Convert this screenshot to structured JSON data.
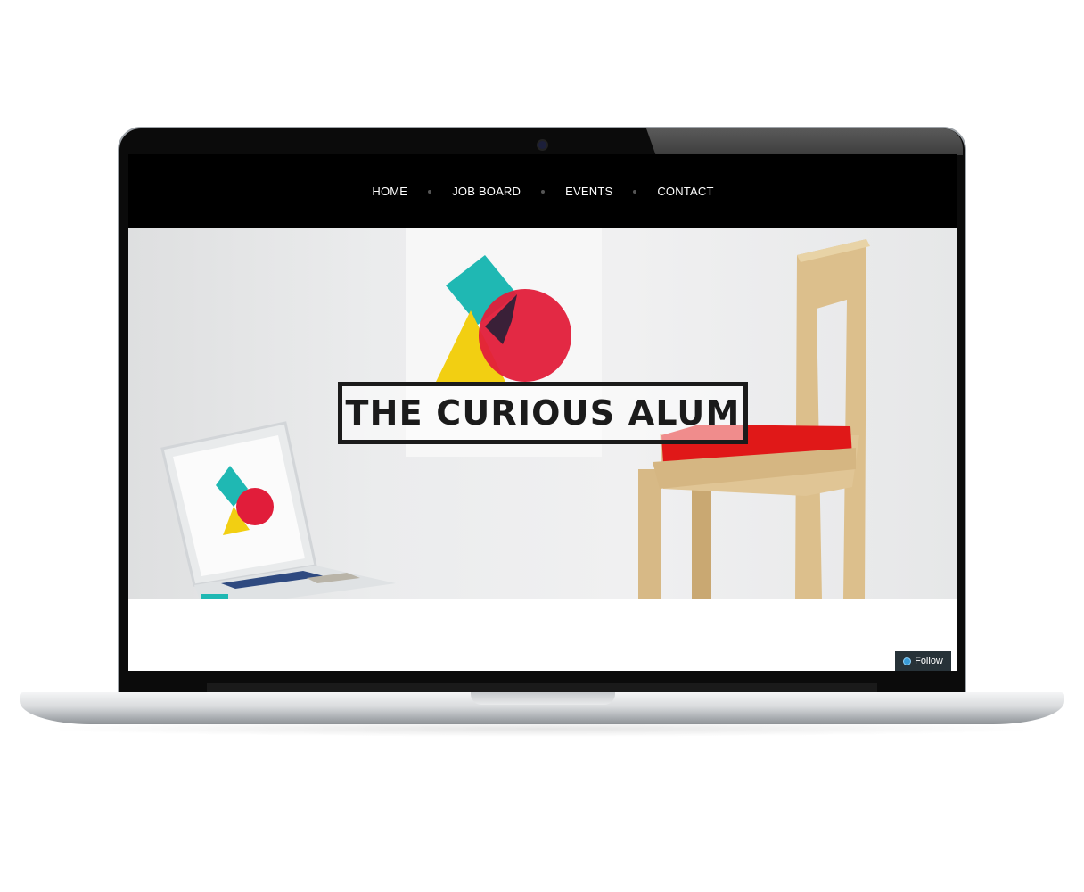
{
  "nav": {
    "items": [
      {
        "label": "HOME"
      },
      {
        "label": "JOB BOARD"
      },
      {
        "label": "EVENTS"
      },
      {
        "label": "CONTACT"
      }
    ]
  },
  "hero": {
    "title": "THE CURIOUS ALUM"
  },
  "follow": {
    "label": "Follow"
  },
  "colors": {
    "teal": "#1fb8b3",
    "red": "#e11d3a",
    "yellow": "#f2cf12",
    "navbar": "#000000",
    "chair_seat": "#e01818"
  }
}
